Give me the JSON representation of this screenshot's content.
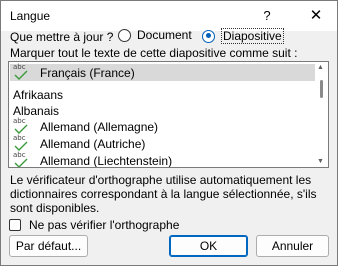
{
  "dialog": {
    "title": "Langue",
    "help": "?",
    "close": "✕"
  },
  "question": "Que mettre à jour ?",
  "radios": {
    "document": "Document",
    "diapositive": "Diapositive",
    "selected": "diapositive"
  },
  "mark_label": "Marquer tout le texte de cette diapositive comme suit :",
  "languages": [
    {
      "label": "Français (France)",
      "spell": true,
      "selected": true
    },
    {
      "label": "Afrikaans",
      "spell": false,
      "selected": false
    },
    {
      "label": "Albanais",
      "spell": false,
      "selected": false
    },
    {
      "label": "Allemand (Allemagne)",
      "spell": true,
      "selected": false
    },
    {
      "label": "Allemand (Autriche)",
      "spell": true,
      "selected": false
    },
    {
      "label": "Allemand (Liechtenstein)",
      "spell": true,
      "selected": false
    }
  ],
  "abc_text": "abc",
  "info": "Le vérificateur d'orthographe utilise automatiquement les dictionnaires correspondant à la langue sélectionnée, s'ils sont disponibles.",
  "no_check": {
    "label": "Ne pas vérifier l'orthographe",
    "checked": false
  },
  "buttons": {
    "default": "Par défaut...",
    "ok": "OK",
    "cancel": "Annuler"
  },
  "colors": {
    "accent": "#005fb8",
    "check_green": "#3a9a3a",
    "selected_row": "#d9d9d9"
  }
}
